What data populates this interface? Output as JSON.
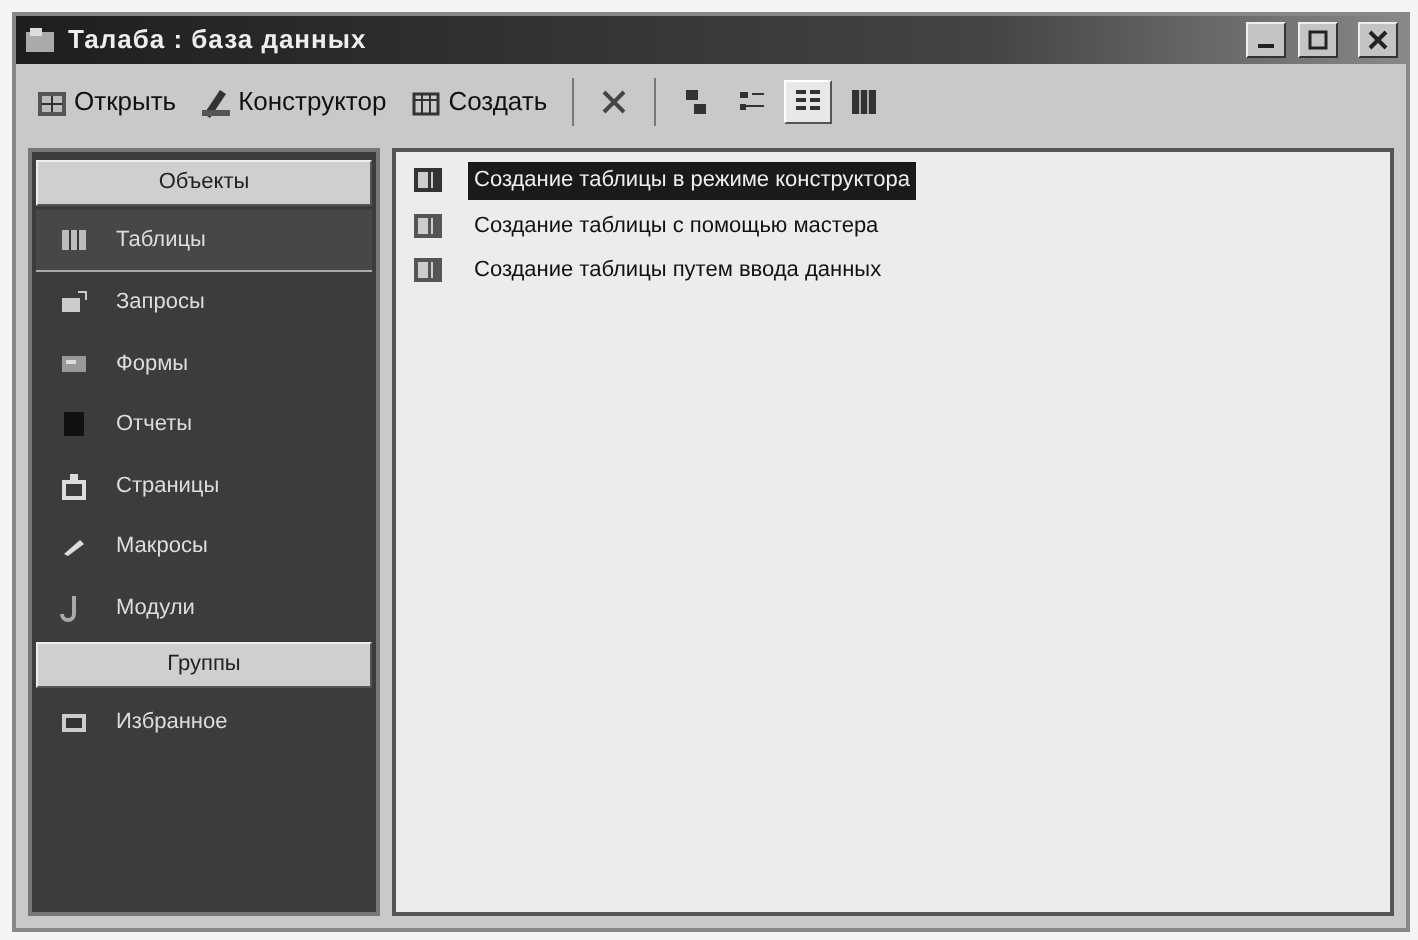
{
  "window": {
    "title": "Талаба : база данных"
  },
  "toolbar": [
    {
      "kind": "text",
      "label": "Открыть",
      "selected": false
    },
    {
      "kind": "text",
      "label": "Конструктор",
      "selected": false
    },
    {
      "kind": "text",
      "label": "Создать",
      "selected": false
    },
    {
      "kind": "icon",
      "selected": false
    },
    {
      "kind": "icon",
      "selected": false
    },
    {
      "kind": "icon",
      "selected": false
    },
    {
      "kind": "icon",
      "selected": true
    },
    {
      "kind": "icon",
      "selected": false
    }
  ],
  "sidebar": {
    "sections": [
      {
        "header": "Объекты",
        "items": [
          {
            "label": "Таблицы",
            "selected": true
          },
          {
            "label": "Запросы",
            "selected": false
          },
          {
            "label": "Формы",
            "selected": false
          },
          {
            "label": "Отчеты",
            "selected": false
          },
          {
            "label": "Страницы",
            "selected": false
          },
          {
            "label": "Макросы",
            "selected": false
          },
          {
            "label": "Модули",
            "selected": false
          }
        ]
      },
      {
        "header": "Группы",
        "items": [
          {
            "label": "Избранное",
            "selected": false
          }
        ]
      }
    ]
  },
  "list": {
    "items": [
      {
        "label": "Создание таблицы в режиме конструктора",
        "selected": true
      },
      {
        "label": "Создание таблицы с помощью мастера",
        "selected": false
      },
      {
        "label": "Создание таблицы путем ввода данных",
        "selected": false
      }
    ]
  }
}
